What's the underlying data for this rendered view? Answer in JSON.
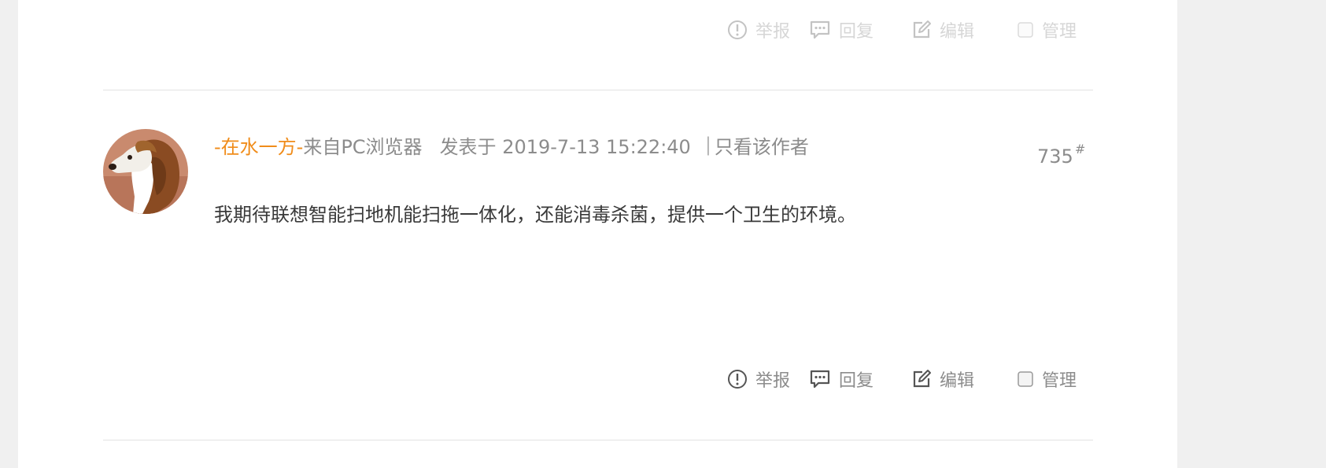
{
  "actions_top": {
    "report": "举报",
    "reply": "回复",
    "edit": "编辑",
    "manage": "管理"
  },
  "post": {
    "author": "-在水一方-",
    "source": "来自PC浏览器",
    "posted_at": "发表于 2019-7-13 15:22:40",
    "separator": "|",
    "only_author": "只看该作者",
    "floor": "735",
    "floor_mark": "#",
    "content": "我期待联想智能扫地机能扫拖一体化，还能消毒杀菌，提供一个卫生的环境。",
    "actions": {
      "report": "举报",
      "reply": "回复",
      "edit": "编辑",
      "manage": "管理"
    }
  },
  "icons": {
    "report": "exclamation-circle-icon",
    "reply": "comment-icon",
    "edit": "edit-icon",
    "manage": "checkbox-icon"
  },
  "colors": {
    "author": "#f08c1a",
    "meta_text": "#8c8c8c",
    "content_text": "#3a3a3a",
    "divider": "#e3e3e3",
    "page_bg": "#f0f0f0"
  }
}
